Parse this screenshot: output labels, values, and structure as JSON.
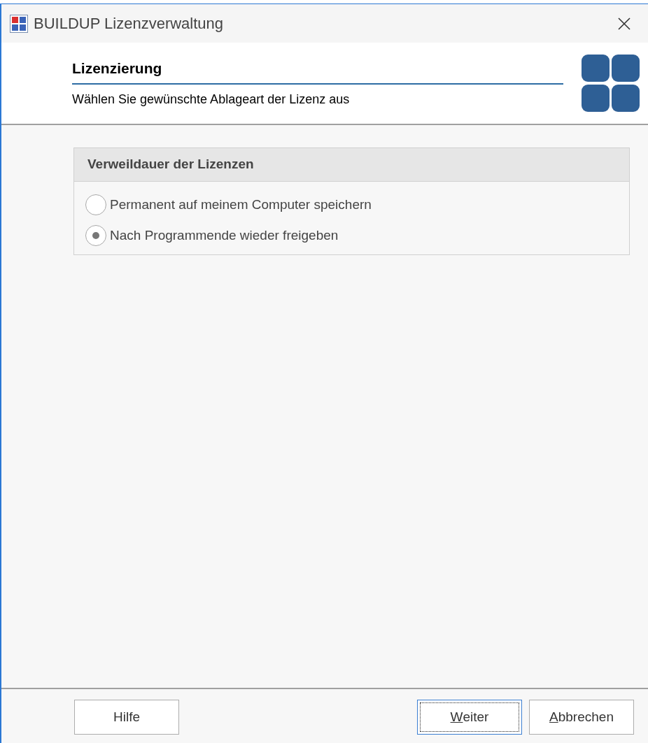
{
  "window": {
    "title": "BUILDUP Lizenzverwaltung"
  },
  "header": {
    "title": "Lizenzierung",
    "subtitle": "Wählen Sie gewünschte Ablageart der Lizenz aus"
  },
  "group": {
    "title": "Verweildauer der Lizenzen",
    "options": [
      {
        "label": "Permanent auf meinem Computer speichern",
        "selected": false
      },
      {
        "label": "Nach Programmende wieder freigeben",
        "selected": true
      }
    ]
  },
  "buttons_left": [
    {
      "label_rest": "Hilfe",
      "focused": false
    }
  ],
  "buttons_right": [
    {
      "mnemonic": "W",
      "label_rest": "eiter",
      "focused": true
    },
    {
      "mnemonic": "A",
      "label_rest": "bbrechen",
      "focused": false
    }
  ]
}
